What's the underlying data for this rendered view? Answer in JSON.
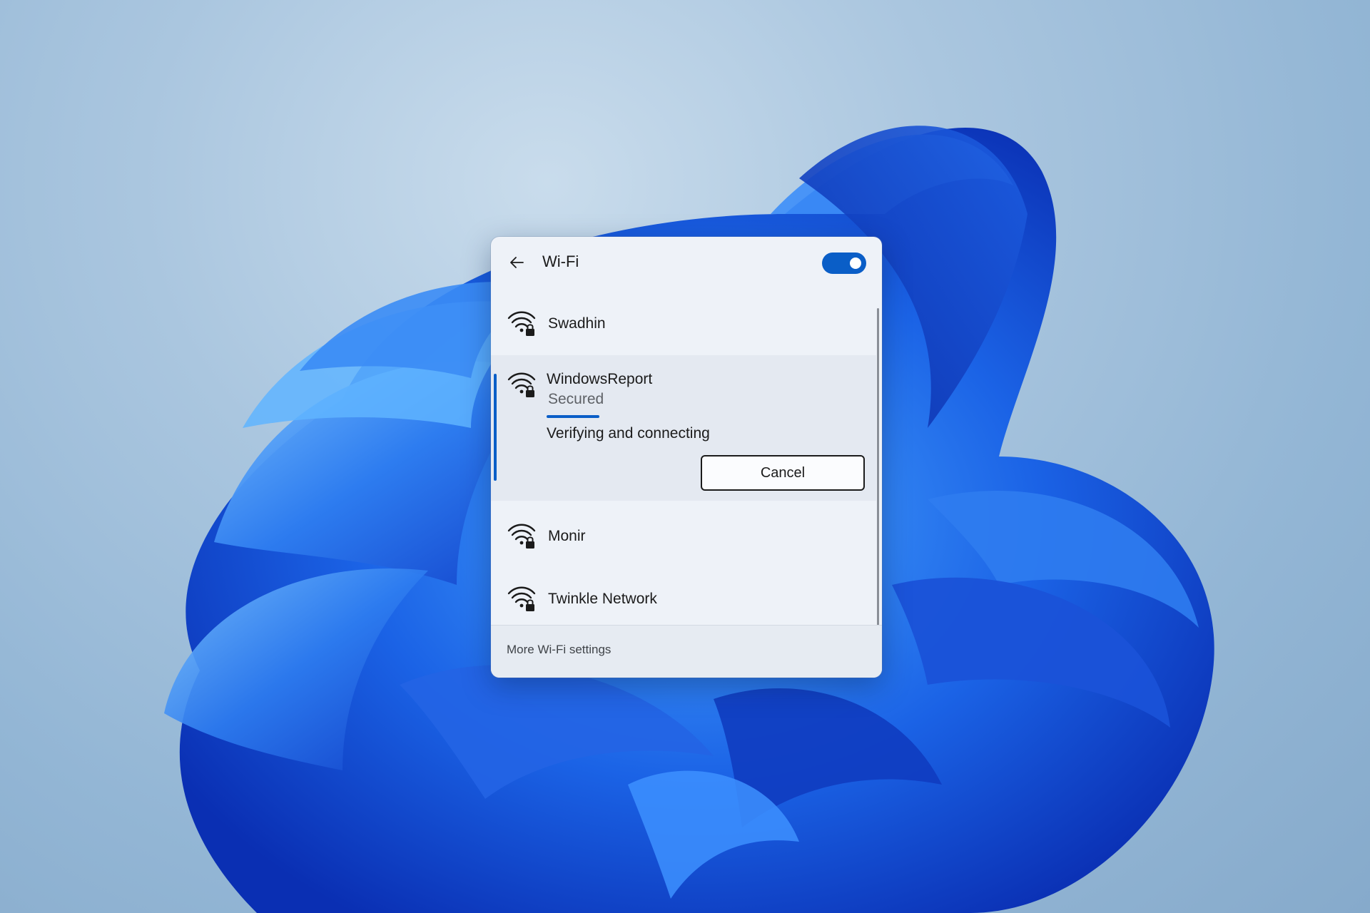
{
  "flyout": {
    "title": "Wi-Fi",
    "wifi_enabled": true,
    "accent_color": "#0a5ec7"
  },
  "networks": [
    {
      "name": "Swadhin",
      "icon": "wifi-secured-icon",
      "state": "available"
    },
    {
      "name": "WindowsReport",
      "icon": "wifi-secured-icon",
      "status": "Secured",
      "state": "connecting",
      "connect_message": "Verifying and connecting",
      "cancel_label": "Cancel"
    },
    {
      "name": "Monir",
      "icon": "wifi-secured-icon",
      "state": "available"
    },
    {
      "name": "Twinkle Network",
      "icon": "wifi-secured-icon",
      "state": "available"
    }
  ],
  "footer": {
    "more_settings_label": "More Wi-Fi settings"
  }
}
